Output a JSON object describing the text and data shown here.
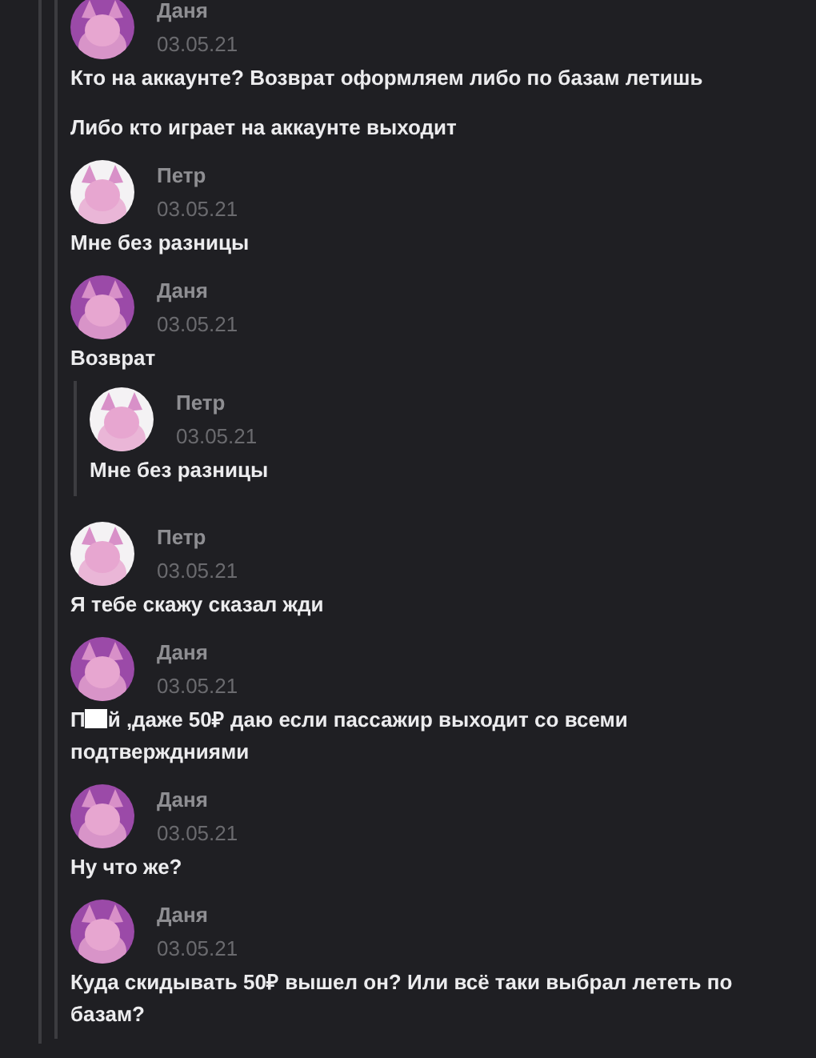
{
  "messages": [
    {
      "author": "Даня",
      "date": "03.05.21",
      "avatar": {
        "kind": "picture",
        "color": "#9b4aa8"
      },
      "lines": [
        {
          "text": "Кто на аккаунте? Возврат оформляем либо по базам летишь"
        },
        {
          "text": "Либо кто играет на аккаунте выходит"
        }
      ]
    },
    {
      "author": "Петр",
      "date": "03.05.21",
      "avatar": {
        "kind": "picture",
        "color": "#f4f2f4"
      },
      "lines": [
        {
          "text": "Мне без разницы"
        }
      ]
    },
    {
      "author": "Даня",
      "date": "03.05.21",
      "avatar": {
        "kind": "picture",
        "color": "#9b4aa8"
      },
      "lines": [
        {
          "text": "Возврат"
        }
      ],
      "quote": {
        "author": "Петр",
        "date": "03.05.21",
        "avatar": {
          "kind": "picture",
          "color": "#f4f2f4"
        },
        "lines": [
          {
            "text": "Мне без разницы"
          }
        ]
      }
    },
    {
      "author": "Петр",
      "date": "03.05.21",
      "avatar": {
        "kind": "picture",
        "color": "#f4f2f4"
      },
      "lines": [
        {
          "text": "Я тебе скажу сказал жди"
        }
      ]
    },
    {
      "author": "Даня",
      "date": "03.05.21",
      "avatar": {
        "kind": "picture",
        "color": "#9b4aa8"
      },
      "lines": [
        {
          "prefix": "П",
          "redacted": true,
          "text": "й ,даже 50₽ даю если пассажир выходит со всеми подтверждниями"
        }
      ]
    },
    {
      "author": "Даня",
      "date": "03.05.21",
      "avatar": {
        "kind": "picture",
        "color": "#9b4aa8"
      },
      "lines": [
        {
          "text": "Ну что же?"
        }
      ]
    },
    {
      "author": "Даня",
      "date": "03.05.21",
      "avatar": {
        "kind": "picture",
        "color": "#9b4aa8"
      },
      "lines": [
        {
          "text": "Куда скидывать 50₽ вышел он? Или всё таки выбрал лететь по базам?"
        }
      ]
    }
  ]
}
